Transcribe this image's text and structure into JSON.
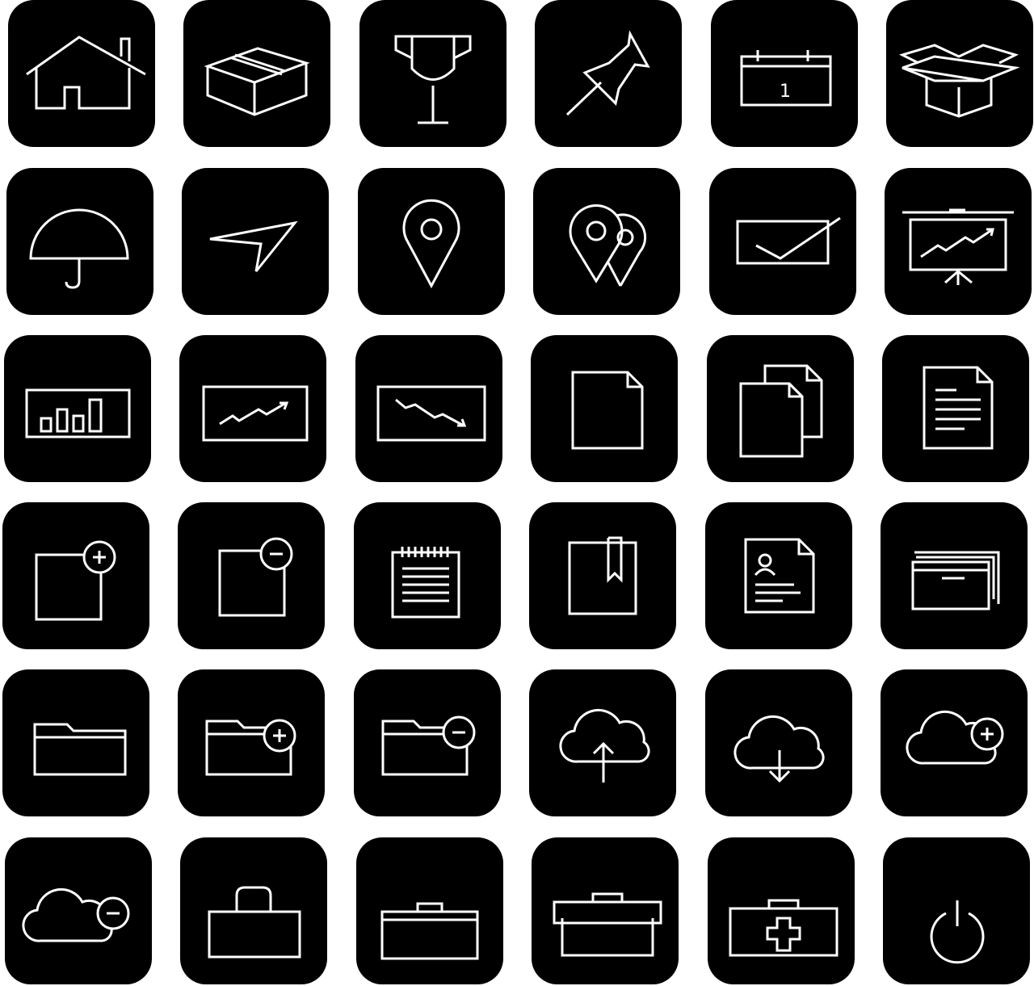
{
  "colors": {
    "tile": "#000000",
    "stroke": "#ffffff",
    "background": "#ffffff"
  },
  "calendar_day": "1",
  "rows": [
    [
      "home-icon",
      "box-icon",
      "trophy-icon",
      "pushpin-icon",
      "calendar-icon",
      "open-box-icon"
    ],
    [
      "umbrella-icon",
      "navigation-arrow-icon",
      "location-pin-icon",
      "multiple-location-pins-icon",
      "check-box-icon",
      "presentation-board-icon"
    ],
    [
      "bar-chart-icon",
      "trending-up-chart-icon",
      "trending-down-chart-icon",
      "blank-document-icon",
      "copy-documents-icon",
      "text-document-icon"
    ],
    [
      "add-document-icon",
      "remove-document-icon",
      "notepad-icon",
      "bookmark-document-icon",
      "resume-document-icon",
      "window-stack-icon"
    ],
    [
      "folder-icon",
      "add-folder-icon",
      "remove-folder-icon",
      "cloud-upload-icon",
      "cloud-download-icon",
      "cloud-add-icon"
    ],
    [
      "cloud-remove-icon",
      "shopping-bag-icon",
      "briefcase-icon",
      "toolbox-icon",
      "first-aid-kit-icon",
      "power-icon"
    ]
  ]
}
